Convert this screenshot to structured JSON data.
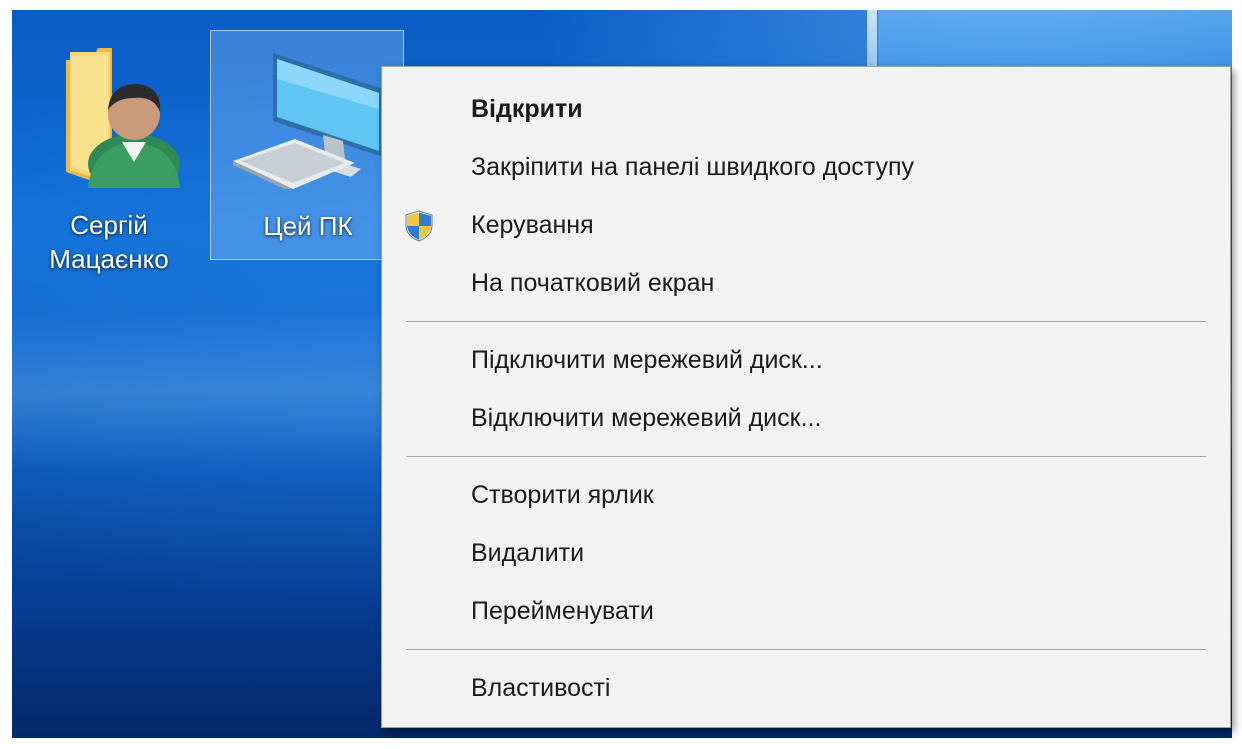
{
  "desktop": {
    "icons": [
      {
        "label": "Сергій\nМацаєнко",
        "icon": "user-folder-icon"
      },
      {
        "label": "Цей ПК",
        "icon": "computer-icon",
        "selected": true
      }
    ],
    "colors": {
      "wallpaper": "#0b5dbf",
      "selection": "#96c8ff"
    }
  },
  "context_menu": {
    "items": [
      {
        "label": "Відкрити",
        "bold": true
      },
      {
        "label": "Закріпити на панелі швидкого доступу"
      },
      {
        "label": "Керування",
        "icon": "uac-shield-icon"
      },
      {
        "label": "На початковий екран"
      },
      {
        "label": "Підключити мережевий диск..."
      },
      {
        "label": "Відключити мережевий диск..."
      },
      {
        "label": "Створити ярлик"
      },
      {
        "label": "Видалити"
      },
      {
        "label": "Перейменувати"
      },
      {
        "label": "Властивості"
      }
    ],
    "colors": {
      "background": "#f2f2f2",
      "separator": "#a6a6a6",
      "text": "#1b1b1b"
    }
  }
}
